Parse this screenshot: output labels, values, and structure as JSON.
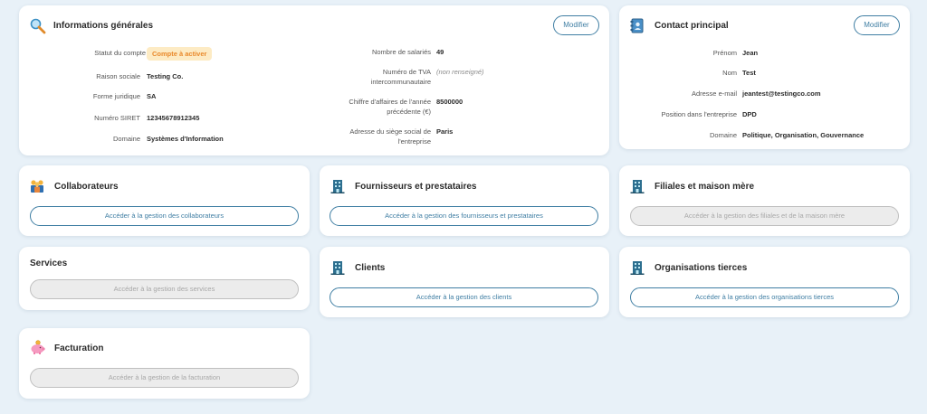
{
  "general": {
    "title": "Informations générales",
    "icon": "magnifier-icon",
    "modify_label": "Modifier",
    "left_fields": [
      {
        "label": "Statut du compte",
        "value": "Compte à activer"
      },
      {
        "label": "Raison sociale",
        "value": "Testing Co."
      },
      {
        "label": "Forme juridique",
        "value": "SA"
      },
      {
        "label": "Numéro SIRET",
        "value": "12345678912345"
      },
      {
        "label": "Domaine",
        "value": "Systèmes d'Information"
      }
    ],
    "right_fields": [
      {
        "label": "Nombre de salariés",
        "value": "49"
      },
      {
        "label": "Numéro de TVA intercommunautaire",
        "value": "(non renseigné)"
      },
      {
        "label": "Chiffre d'affaires de l'année précédente (€)",
        "value": "8500000"
      },
      {
        "label": "Adresse du siège social de l'entreprise",
        "value": "Paris"
      }
    ]
  },
  "contact": {
    "title": "Contact principal",
    "icon": "address-book-icon",
    "modify_label": "Modifier",
    "fields": [
      {
        "label": "Prénom",
        "value": "Jean"
      },
      {
        "label": "Nom",
        "value": "Test"
      },
      {
        "label": "Adresse e-mail",
        "value": "jeantest@testingco.com"
      },
      {
        "label": "Position dans l'entreprise",
        "value": "DPD"
      },
      {
        "label": "Domaine",
        "value": "Politique, Organisation, Gouvernance"
      }
    ]
  },
  "modules": {
    "collaborateurs": {
      "title": "Collaborateurs",
      "icon": "people-icon",
      "button": "Accéder à la gestion des collaborateurs"
    },
    "fournisseurs": {
      "title": "Fournisseurs et prestataires",
      "icon": "building-icon",
      "button": "Accéder à la gestion des fournisseurs et prestataires"
    },
    "filiales": {
      "title": "Filiales et maison mère",
      "icon": "building-icon",
      "button": "Accéder à la gestion des filiales et de la maison mère"
    },
    "services": {
      "title": "Services",
      "button": "Accéder à la gestion des services"
    },
    "clients": {
      "title": "Clients",
      "icon": "building-icon",
      "button": "Accéder à la gestion des clients"
    },
    "organisations": {
      "title": "Organisations tierces",
      "icon": "building-icon",
      "button": "Accéder à la gestion des organisations tierces"
    },
    "facturation": {
      "title": "Facturation",
      "icon": "piggy-bank-icon",
      "button": "Accéder à la gestion de la facturation"
    }
  },
  "colors": {
    "background": "#e8f1f8",
    "accent": "#3f7ea3",
    "badge_text": "#e9892b",
    "badge_bg": "#fdebc4",
    "disabled_bg": "#ececec"
  }
}
